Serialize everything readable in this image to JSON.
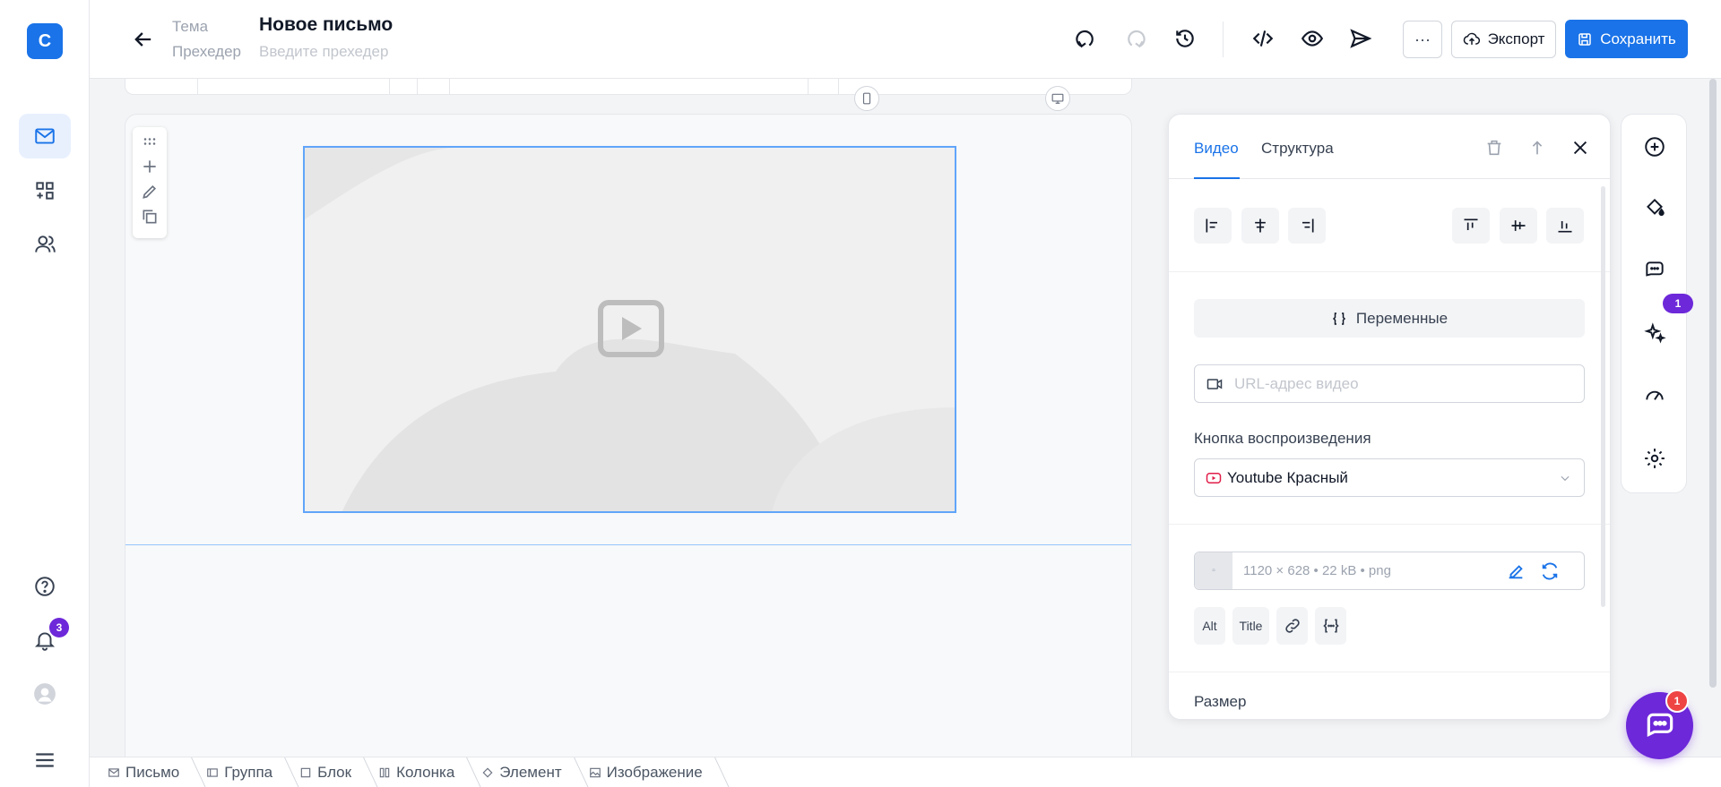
{
  "app": {
    "logo_letter": "C",
    "accent": "#1a73e8",
    "badge_color": "#6d28d9"
  },
  "rail": {
    "items": [
      {
        "name": "mail",
        "icon": "mail-icon",
        "active": true
      },
      {
        "name": "templates",
        "icon": "grid-plus-icon"
      },
      {
        "name": "contacts",
        "icon": "users-icon"
      }
    ],
    "help_icon": "help-icon",
    "notifications_count": "3",
    "avatar_icon": "user-avatar-icon",
    "menu_icon": "menu-icon"
  },
  "header": {
    "subject_label": "Тема",
    "preheader_label": "Прехедер",
    "title": "Новое письмо",
    "preheader_placeholder": "Введите прехедер",
    "more_label": "···",
    "export_label": "Экспорт",
    "save_label": "Сохранить"
  },
  "breadcrumbs": [
    "Письмо",
    "Группа",
    "Блок",
    "Колонка",
    "Элемент",
    "Изображение"
  ],
  "panel": {
    "tabs": [
      "Видео",
      "Структура"
    ],
    "variables_label": "Переменные",
    "url_placeholder": "URL-адрес видео",
    "play_button_label": "Кнопка воспроизведения",
    "play_button_value": "Youtube Красный",
    "image_meta": "1120 × 628  •  22 kB  •  png",
    "chips": [
      "Alt",
      "Title"
    ],
    "size_label": "Размер"
  },
  "side_tools": {
    "ai_badge": "1"
  },
  "chat": {
    "badge": "1"
  }
}
